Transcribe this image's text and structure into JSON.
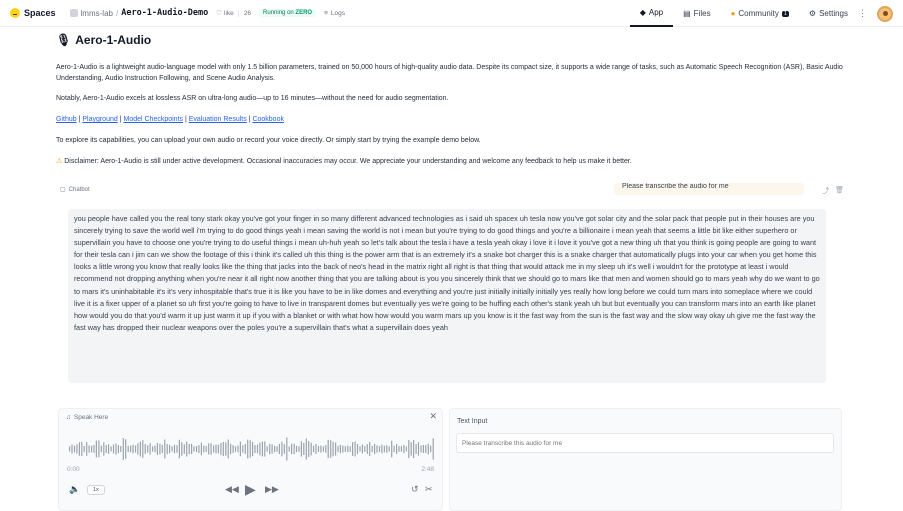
{
  "nav": {
    "brand": "Spaces",
    "org": "lmms-lab",
    "separator": "/",
    "repo": "Aero-1-Audio-Demo",
    "like_label": "like",
    "like_count": "26",
    "status_prefix": "Running on ",
    "status_highlight": "ZERO",
    "logs_label": "Logs",
    "tabs": [
      {
        "label": "App",
        "active": true,
        "icon": "app-icon"
      },
      {
        "label": "Files",
        "active": false,
        "icon": "files-icon"
      },
      {
        "label": "Community",
        "active": false,
        "icon": "community-icon",
        "badge": "1"
      },
      {
        "label": "Settings",
        "active": false,
        "icon": "gear-icon"
      }
    ]
  },
  "page": {
    "title": "Aero-1-Audio",
    "intro": "Aero-1-Audio is a lightweight audio-language model with only 1.5 billion parameters, trained on 50,000 hours of high-quality audio data. Despite its compact size, it supports a wide range of tasks, such as Automatic Speech Recognition (ASR), Basic Audio Understanding, Audio Instruction Following, and Scene Audio Analysis.",
    "notably": "Notably, Aero-1-Audio excels at lossless ASR on ultra-long audio—up to 16 minutes—without the need for audio segmentation.",
    "links": [
      "Github",
      "Playground",
      "Model Checkpoints",
      "Evaluation Results",
      "Cookbook"
    ],
    "link_separator": " | ",
    "explore": "To explore its capabilities, you can upload your own audio or record your voice directly. Or simply start by trying the example demo below.",
    "disclaimer": "Disclaimer: Aero-1-Audio is still under active development. Occasional inaccuracies may occur. We appreciate your understanding and welcome any feedback to help us make it better."
  },
  "chatbot": {
    "label": "Chatbot",
    "user_message": "Please transcribe the audio for me",
    "bot_message": "you people have called you the real tony stark okay you've got your finger in so many different advanced technologies as i said uh spacex uh tesla now you've got solar city and the solar pack that people put in their houses are you sincerely trying to save the world well i'm trying to do good things yeah i mean saving the world is not i mean but you're trying to do good things and you're a billionaire i mean yeah that seems a little bit like either superhero or supervillain you have to choose one you're trying to do useful things i mean uh-huh yeah so let's talk about the tesla i have a tesla yeah okay i love it i love it you've got a new thing uh that you think is going people are going to want for their tesla can i jim can we show the footage of this i think it's called uh this thing is the power arm that is an extremely it's a snake bot charger this is a snake charger that automatically plugs into your car when you get home this looks a little wrong you know that really looks like the thing that jacks into the back of neo's head in the matrix right all right is that thing that would attack me in my sleep uh it's well i wouldn't for the prototype at least i would recommend not dropping anything when you're near it all right now another thing that you are talking about is you you sincerely think that we should go to mars like that men and women should go to mars yeah why do we want to go to mars it's uninhabitable it's it's very inhospitable that's true it is like you have to be in like domes and everything and you're just initially initially initially yes really how long before we could turn mars into someplace where we could live it is a fixer upper of a planet so uh first you're going to have to live in transparent domes but eventually yes we're going to be huffing each other's stank yeah uh but but eventually you can transform mars into an earth like planet how would you do that you'd warm it up just warm it up if you with a blanket or with what how how would you warm mars up you know is it the fast way from the sun is the fast way and the slow way okay uh give me the fast way the fast way has dropped their nuclear weapons over the poles you're a supervillain that's what a supervillain does yeah"
  },
  "audio": {
    "label": "Speak Here",
    "time_start": "0:00",
    "time_end": "2:48",
    "speed": "1x"
  },
  "text_input": {
    "label": "Text Input",
    "placeholder": "Please transcribe this audio for me"
  }
}
